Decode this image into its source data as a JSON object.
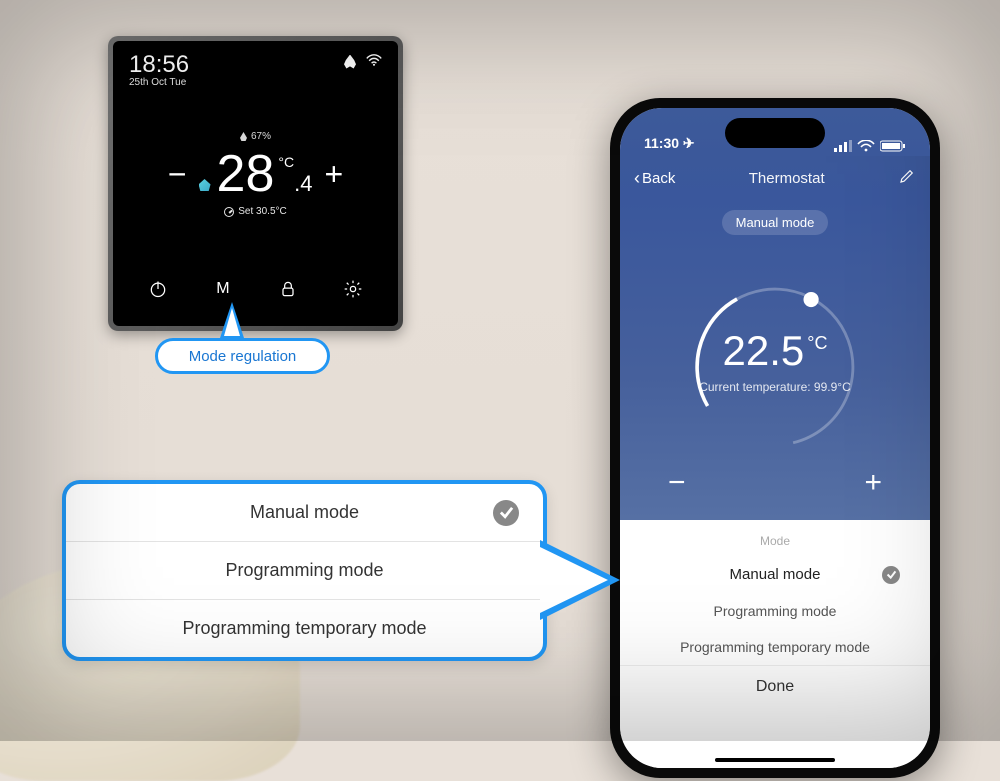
{
  "thermostat": {
    "time": "18:56",
    "date": "25th Oct Tue",
    "humidity": "67%",
    "current_temp_int": "28",
    "current_temp_frac": ".4",
    "current_temp_unit": "°C",
    "set_label": "Set 30.5°C",
    "nav": {
      "mode_label": "M"
    }
  },
  "callout_label": "Mode regulation",
  "phone": {
    "status_time": "11:30",
    "header": {
      "back": "Back",
      "title": "Thermostat"
    },
    "mode_chip": "Manual mode",
    "dial_temp": "22.5",
    "dial_unit": "°C",
    "current_label": "Current temperature: 99.9°C",
    "picker_header": "Mode",
    "options": [
      {
        "label": "Manual mode",
        "selected": true
      },
      {
        "label": "Programming mode",
        "selected": false
      },
      {
        "label": "Programming temporary mode",
        "selected": false
      }
    ],
    "done": "Done"
  },
  "big_callout": {
    "options": [
      {
        "label": "Manual mode",
        "selected": true
      },
      {
        "label": "Programming mode",
        "selected": false
      },
      {
        "label": "Programming temporary mode",
        "selected": false
      }
    ]
  }
}
